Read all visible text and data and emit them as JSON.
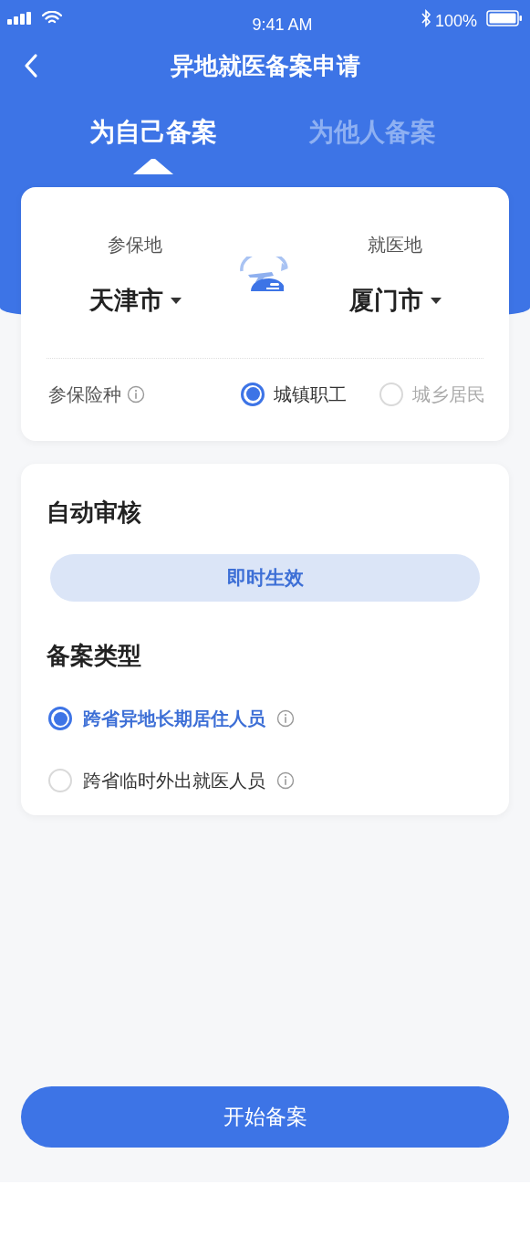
{
  "status_bar": {
    "time": "9:41 AM",
    "battery": "100%"
  },
  "title": "异地就医备案申请",
  "tabs": [
    {
      "label": "为自己备案",
      "selected": true
    },
    {
      "label": "为他人备案",
      "selected": false
    }
  ],
  "locations": [
    {
      "label": "参保地",
      "value": "天津市"
    },
    {
      "label": "就医地",
      "value": "厦门市"
    }
  ],
  "insurance": {
    "label": "参保险种",
    "options": [
      {
        "label": "城镇职工",
        "selected": true
      },
      {
        "label": "城乡居民",
        "selected": false
      }
    ]
  },
  "review": {
    "title": "自动审核",
    "badge": "即时生效"
  },
  "filing_type": {
    "title": "备案类型",
    "options": [
      {
        "label": "跨省异地长期居住人员",
        "selected": true
      },
      {
        "label": "跨省临时外出就医人员",
        "selected": false
      }
    ]
  },
  "submit": "开始备案"
}
